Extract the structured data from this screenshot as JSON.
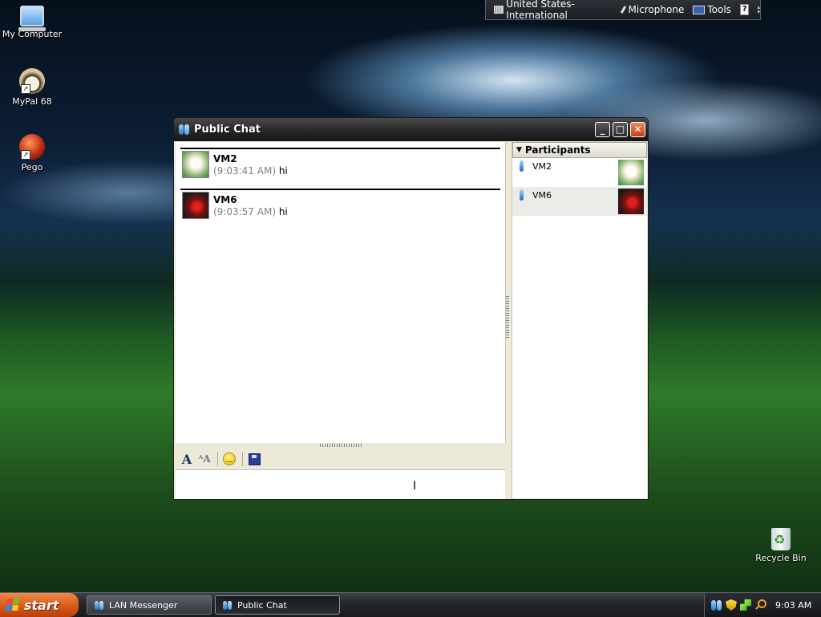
{
  "desktop": {
    "icons": [
      {
        "label": "My Computer"
      },
      {
        "label": "MyPal 68"
      },
      {
        "label": "Pego"
      },
      {
        "label": "Recycle Bin"
      }
    ]
  },
  "language_bar": {
    "language": "United States-International",
    "microphone": "Microphone",
    "tools": "Tools",
    "help": "?"
  },
  "window": {
    "title": "Public Chat",
    "minimize": "_",
    "maximize": "□",
    "close": "✕",
    "messages": [
      {
        "sender": "VM2",
        "time": "(9:03:41 AM)",
        "text": "hi"
      },
      {
        "sender": "VM6",
        "time": "(9:03:57 AM)",
        "text": "hi"
      }
    ],
    "participants": {
      "header": "Participants",
      "items": [
        {
          "name": "VM2"
        },
        {
          "name": "VM6"
        }
      ]
    },
    "input": {
      "value": "",
      "placeholder": ""
    }
  },
  "taskbar": {
    "start": "start",
    "buttons": [
      {
        "label": "LAN Messenger"
      },
      {
        "label": "Public Chat"
      }
    ],
    "clock": "9:03 AM"
  }
}
